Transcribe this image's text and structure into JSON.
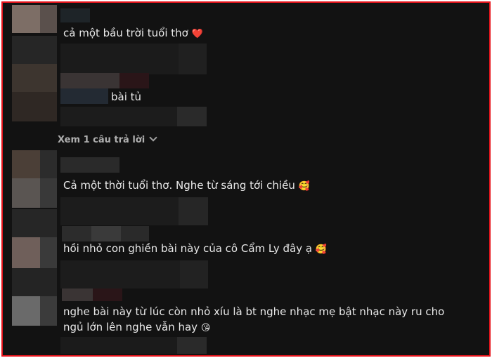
{
  "reply_toggle": {
    "label": "Xem 1 câu trả lời"
  },
  "comments": [
    {
      "text": "cả một bầu trời tuổi thơ",
      "emoji": "❤️"
    },
    {
      "text": "bài tủ",
      "emoji": ""
    },
    {
      "text": "Cả một thời tuổi thơ. Nghe từ sáng tới chiều",
      "emoji": "🥰"
    },
    {
      "text": "hồi nhỏ con ghiền bài này của cô Cẩm Ly đây ạ",
      "emoji": "🥰"
    },
    {
      "text_line1": "nghe bài này từ lúc còn nhỏ xíu là bt nghe nhạc mẹ bật nhạc này ru cho",
      "text_line2": "ngủ lớn lên nghe vẫn hay",
      "emoji": "😘"
    }
  ],
  "colors": {
    "border": "#e8141c",
    "background": "#121212",
    "heart": "#e0245e"
  }
}
